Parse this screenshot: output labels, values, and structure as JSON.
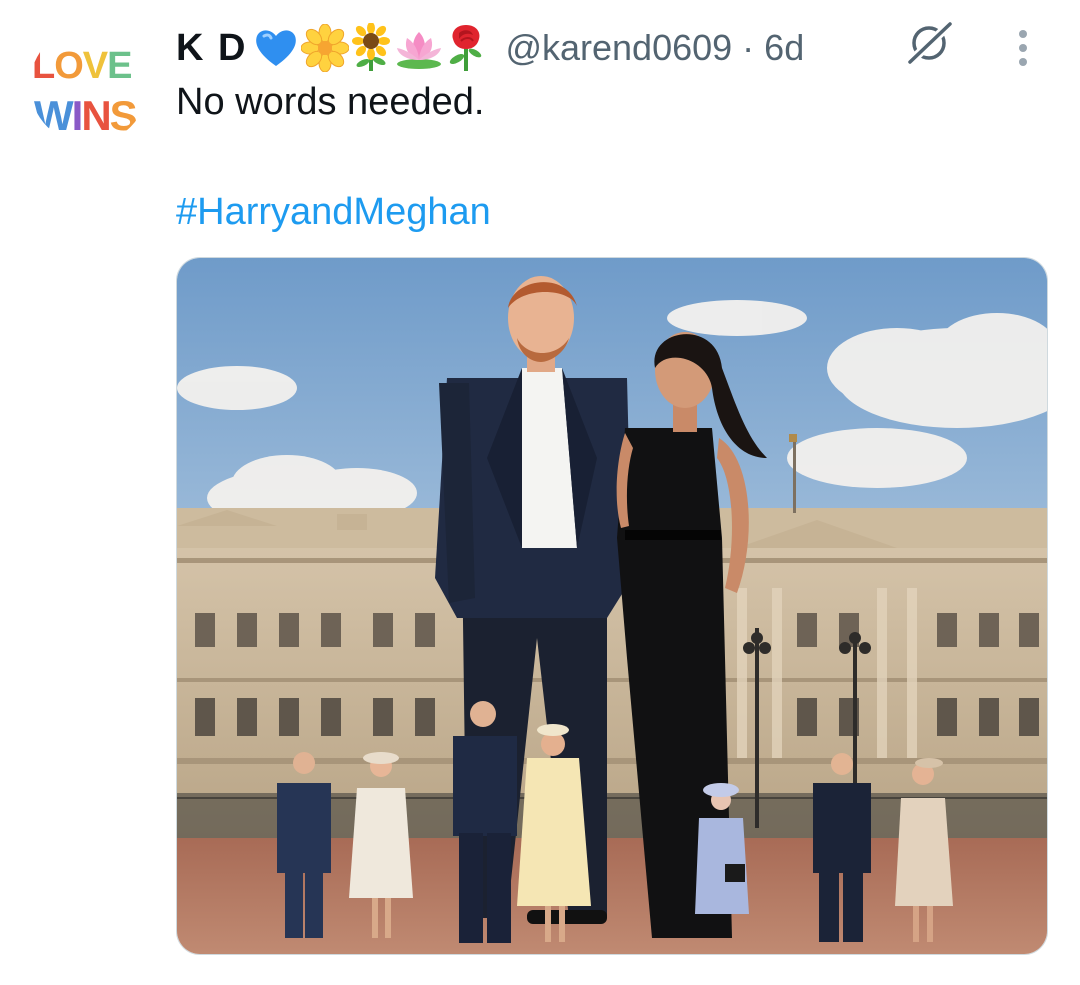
{
  "avatar": {
    "icon": "love-wins-logo",
    "logo_text": [
      "LOVE",
      "WINS"
    ]
  },
  "tweet": {
    "display_name": "K D",
    "name_emojis": [
      "blue-heart-icon",
      "blossom-icon",
      "sunflower-icon",
      "lotus-icon",
      "rose-icon"
    ],
    "handle": "@karend0609",
    "separator": "·",
    "time": "6d",
    "text": "No words needed.",
    "hashtag": "#HarryandMeghan"
  },
  "media": {
    "icon": "photo-couple-palace"
  },
  "colors": {
    "text": "#0f1419",
    "secondary": "#536471",
    "link": "#1d9bf0",
    "background": "#ffffff"
  }
}
